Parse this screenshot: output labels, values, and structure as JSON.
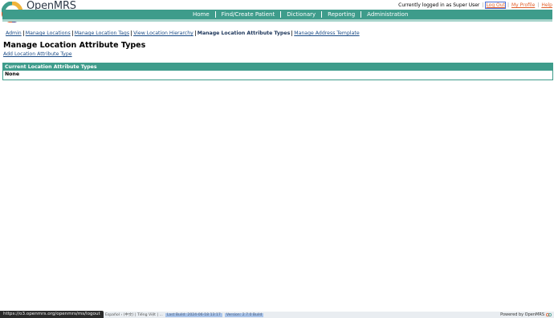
{
  "brand": {
    "name": "OpenMRS"
  },
  "userbar": {
    "status": "Currently logged in as Super User",
    "logout": "Log Out",
    "profile": "My Profile",
    "help": "Help",
    "separator": "|"
  },
  "topnav": {
    "items": [
      "Home",
      "Find/Create Patient",
      "Dictionary",
      "Reporting",
      "Administration"
    ]
  },
  "subnav": {
    "items": [
      {
        "label": "Admin",
        "current": false
      },
      {
        "label": "Manage Locations",
        "current": false
      },
      {
        "label": "Manage Location Tags",
        "current": false
      },
      {
        "label": "View Location Hierarchy",
        "current": false
      },
      {
        "label": "Manage Location Attribute Types",
        "current": true
      },
      {
        "label": "Manage Address Template",
        "current": false
      }
    ]
  },
  "page": {
    "title": "Manage Location Attribute Types",
    "add_link": "Add Location Attribute Type"
  },
  "panel": {
    "header": "Current Location Attribute Types",
    "empty": "None"
  },
  "footer": {
    "status_url": "https://o3.openmrs.org/openmrs/ms/logout",
    "locale_text": "ru  ›  fr  ›  ...  ›  Español  ›  (中文)  |  Tiếng Việt  |  ...",
    "build_text": "Last Build: 2024-06-18 13:17",
    "version_text": "Version: 2.7.0 Build",
    "powered": "Powered by OpenMRS"
  },
  "colors": {
    "accent": "#3e9c8b",
    "link": "#1a4b86",
    "user_link": "#e15e2a"
  }
}
